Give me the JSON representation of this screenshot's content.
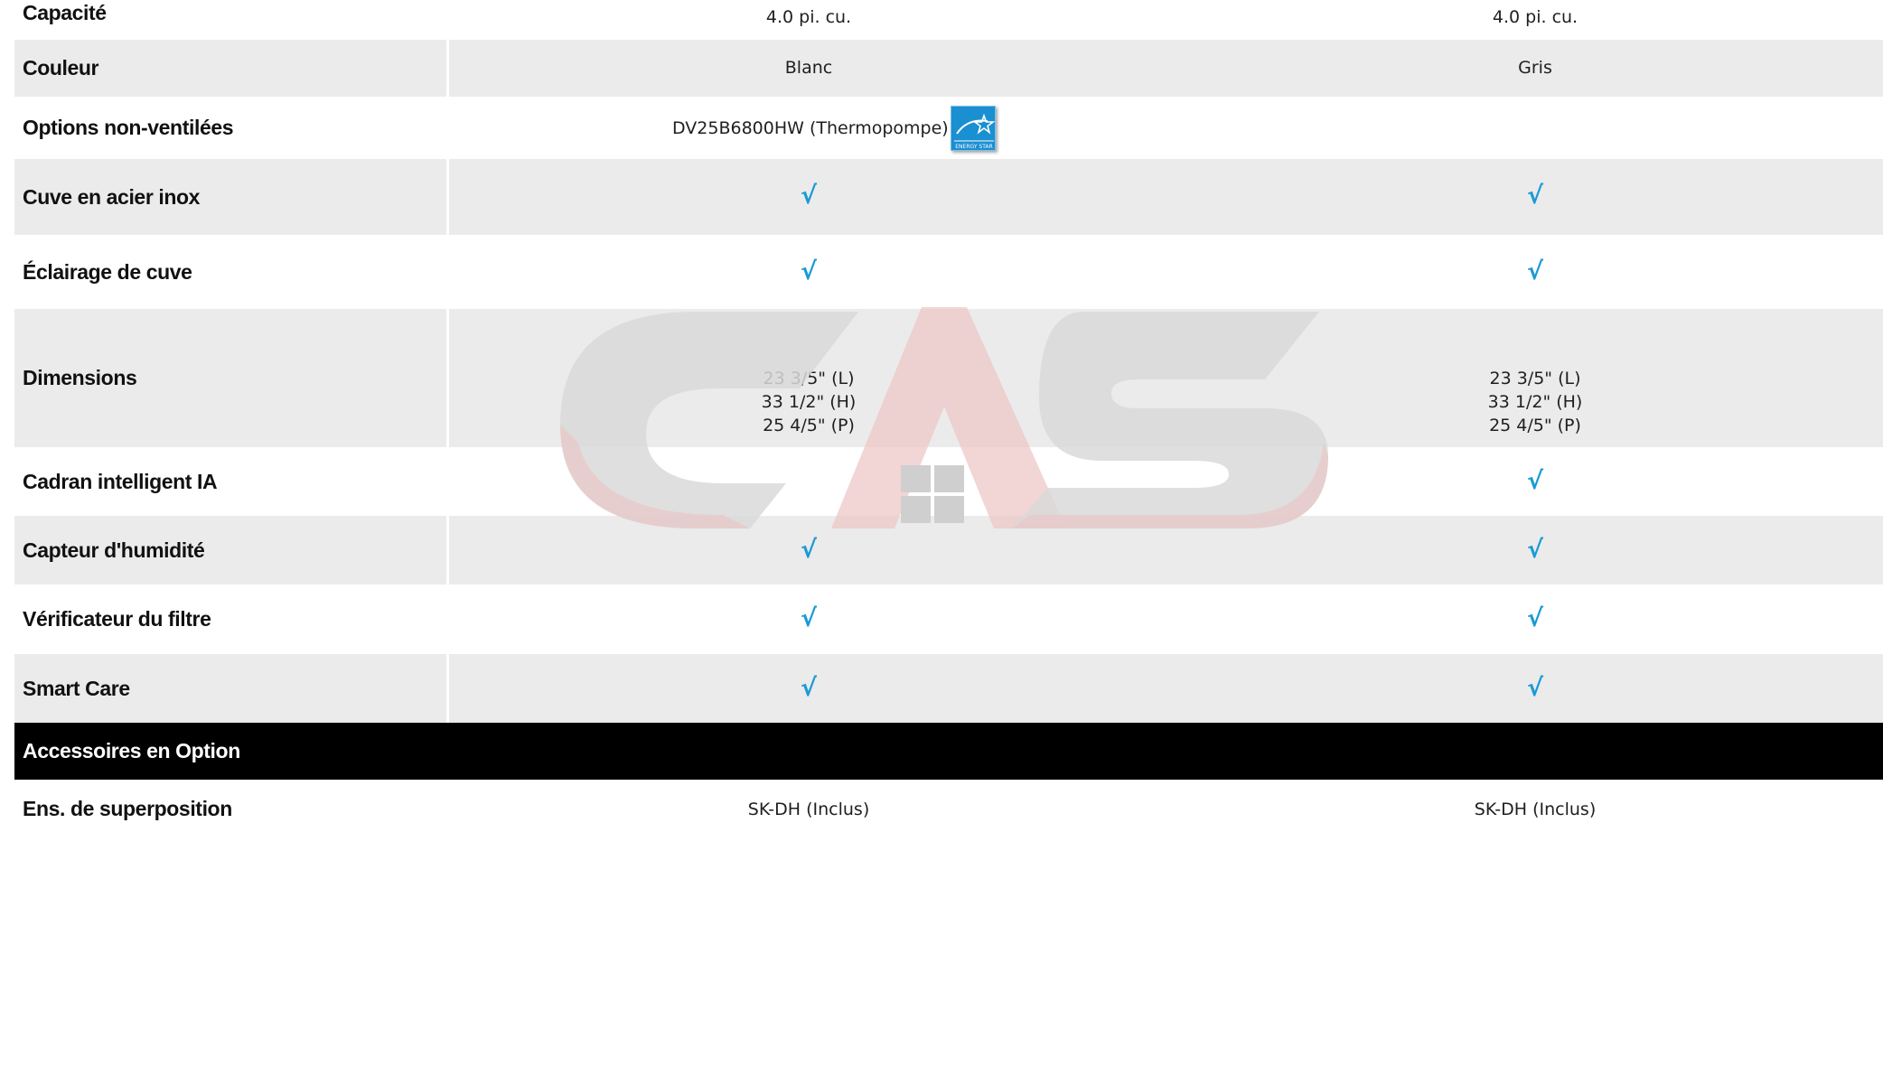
{
  "rows": [
    {
      "label": "Capacité",
      "col1": "4.0 pi. cu.",
      "col2": "4.0 pi. cu."
    },
    {
      "label": "Couleur",
      "col1": "Blanc",
      "col2": "Gris"
    },
    {
      "label": "Options non-ventilées",
      "col1": "DV25B6800HW (Thermopompe)",
      "col2": ""
    },
    {
      "label": "Cuve en acier inox",
      "col1": "√",
      "col2": "√"
    },
    {
      "label": "Éclairage de cuve",
      "col1": "√",
      "col2": "√"
    },
    {
      "label": "Dimensions",
      "col1_lines": [
        "23 3/5\" (L)",
        "33 1/2\" (H)",
        "25 4/5\" (P)"
      ],
      "col2_lines": [
        "23 3/5\" (L)",
        "33 1/2\" (H)",
        "25 4/5\" (P)"
      ]
    },
    {
      "label": "Cadran intelligent IA",
      "col1": "",
      "col2": "√"
    },
    {
      "label": "Capteur d'humidité",
      "col1": "√",
      "col2": "√"
    },
    {
      "label": "Vérificateur du filtre",
      "col1": "√",
      "col2": "√"
    },
    {
      "label": "Smart Care",
      "col1": "√",
      "col2": "√"
    },
    {
      "label": "Accessoires en Option"
    },
    {
      "label": "Ens. de superposition",
      "col1": "SK-DH (Inclus)",
      "col2": "SK-DH (Inclus)"
    }
  ],
  "badge": {
    "icon": "energy-star-icon",
    "text": "ENERGY STAR"
  },
  "watermark": {
    "text": "CAS",
    "icon": "window-logo-icon"
  },
  "colors": {
    "row_gray": "#ebebeb",
    "header_black": "#000000",
    "check_blue": "#1a9ad6",
    "energy_star_blue": "#1a8fd2"
  }
}
